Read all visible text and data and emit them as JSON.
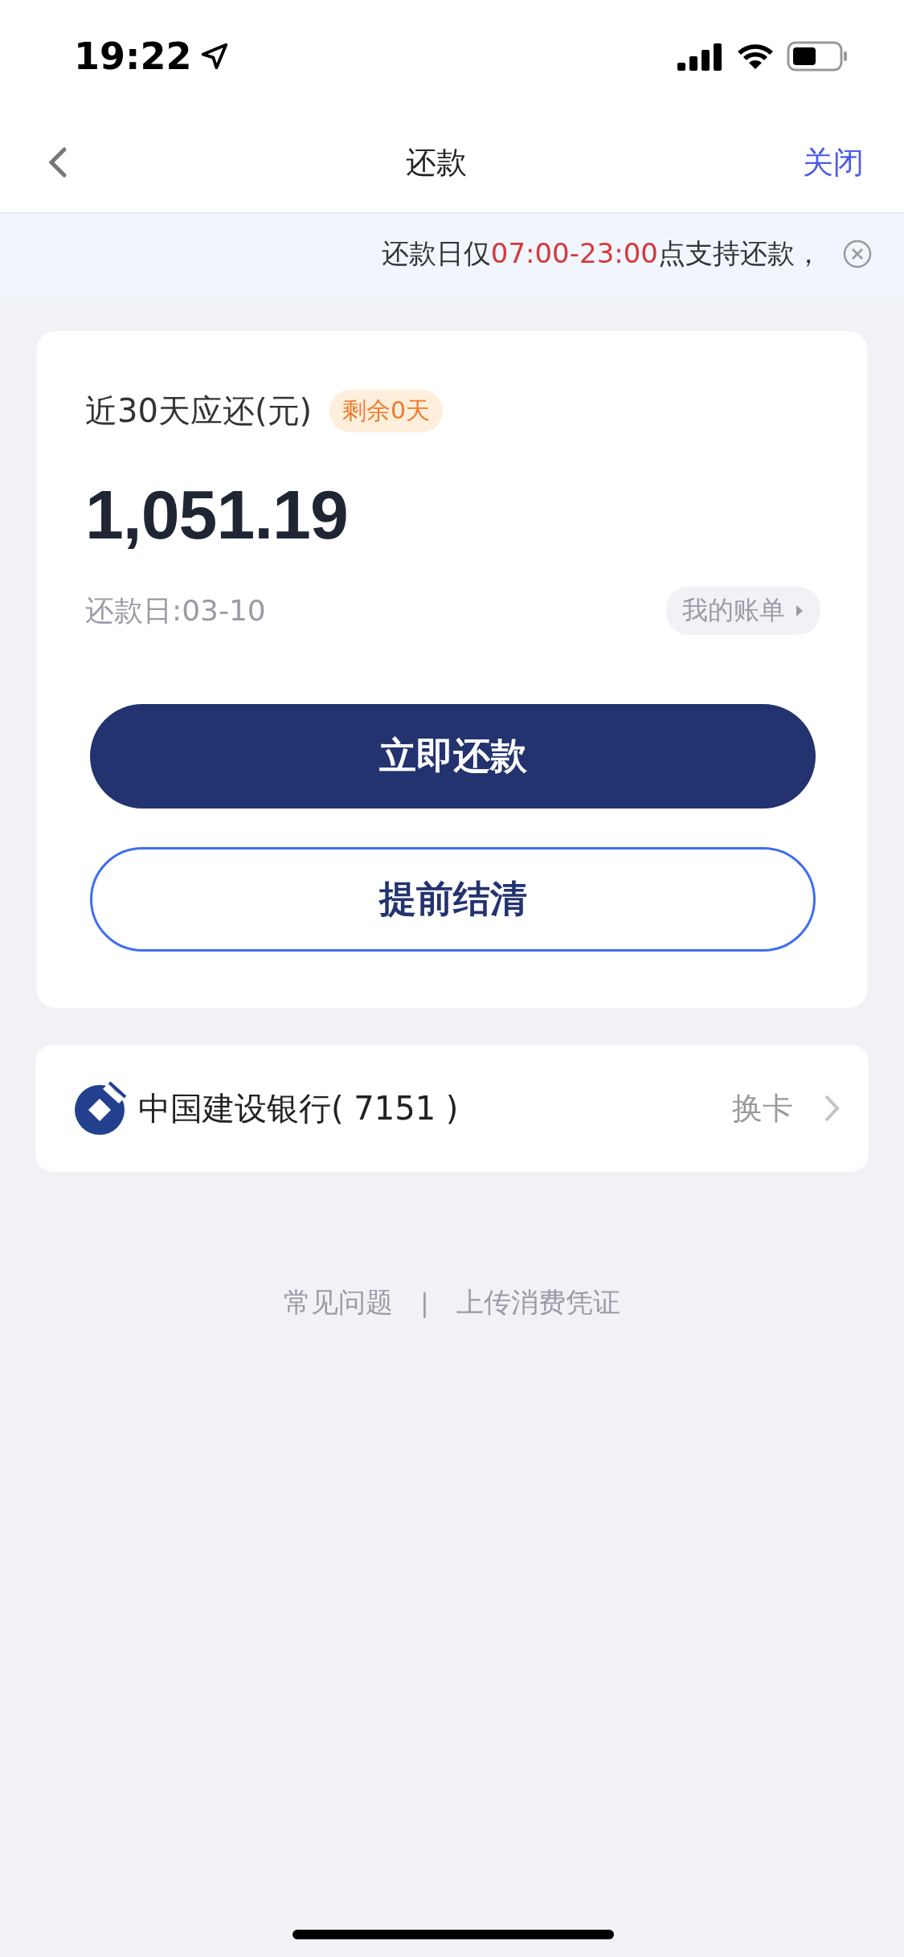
{
  "status_bar": {
    "time": "19:22"
  },
  "nav": {
    "title": "还款",
    "close": "关闭"
  },
  "notice": {
    "parts": [
      {
        "text": "还款日仅",
        "highlight": false
      },
      {
        "text": "07:00-23:00",
        "highlight": true
      },
      {
        "text": "点支持还款，",
        "highlight": false
      }
    ]
  },
  "summary": {
    "label": "近30天应还(元)",
    "badge": "剩余0天",
    "amount": "1,051.19",
    "due_date": "还款日:03-10",
    "bill_link": "我的账单"
  },
  "buttons": [
    {
      "label": "立即还款",
      "kind": "primary"
    },
    {
      "label": "提前结清",
      "kind": "outline"
    }
  ],
  "bank_card": {
    "name": "中国建设银行( 7151 )",
    "action": "换卡"
  },
  "footer": {
    "links": [
      "常见问题",
      "上传消费凭证"
    ],
    "separator": "|"
  }
}
